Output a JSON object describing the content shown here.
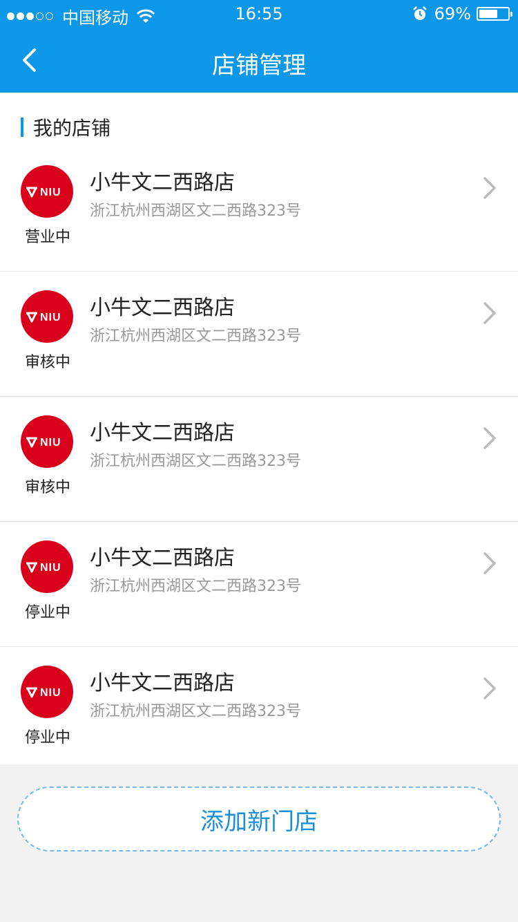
{
  "status_bar": {
    "carrier": "中国移动",
    "time": "16:55",
    "battery": "69%",
    "battery_level": 0.69,
    "signal_filled": 3,
    "signal_total": 5
  },
  "nav": {
    "title": "店铺管理",
    "back_icon": "chevron-left-icon"
  },
  "section": {
    "title": "我的店铺"
  },
  "stores": [
    {
      "logo_text": "NIU",
      "status": "营业中",
      "name": "小牛文二西路店",
      "address": "浙江杭州西湖区文二西路323号"
    },
    {
      "logo_text": "NIU",
      "status": "审核中",
      "name": "小牛文二西路店",
      "address": "浙江杭州西湖区文二西路323号"
    },
    {
      "logo_text": "NIU",
      "status": "审核中",
      "name": "小牛文二西路店",
      "address": "浙江杭州西湖区文二西路323号"
    },
    {
      "logo_text": "NIU",
      "status": "停业中",
      "name": "小牛文二西路店",
      "address": "浙江杭州西湖区文二西路323号"
    },
    {
      "logo_text": "NIU",
      "status": "停业中",
      "name": "小牛文二西路店",
      "address": "浙江杭州西湖区文二西路323号"
    }
  ],
  "footer": {
    "add_button_label": "添加新门店"
  },
  "colors": {
    "primary": "#0d97e8",
    "logo_red": "#d9001b",
    "add_button_text": "#1a8fdc"
  }
}
